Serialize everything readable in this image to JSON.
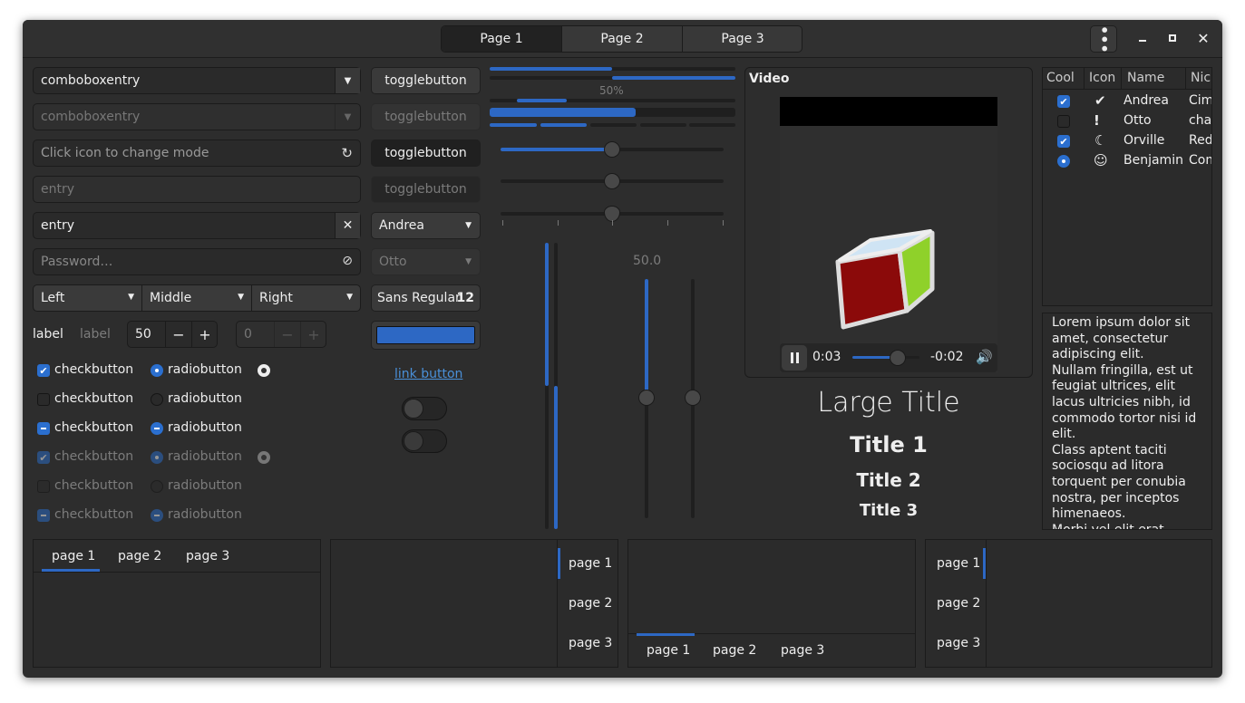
{
  "header": {
    "tabs": [
      "Page 1",
      "Page 2",
      "Page 3"
    ],
    "menu_icon": "more-vert-icon",
    "minimize_icon": "minimize-icon",
    "maximize_icon": "maximize-icon",
    "close_icon": "close-icon"
  },
  "col1": {
    "combo1": "comboboxentry",
    "combo2": "comboboxentry",
    "mode_ph": "Click icon to change mode",
    "entry_ph": "entry",
    "entry_val": "entry",
    "pass_ph": "Password…",
    "left": "Left",
    "middle": "Middle",
    "right": "Right",
    "label1": "label",
    "label2": "label",
    "spin1": "50",
    "spin2": "0",
    "checks": [
      "checkbutton",
      "checkbutton",
      "checkbutton",
      "checkbutton",
      "checkbutton",
      "checkbutton"
    ],
    "radios": [
      "radiobutton",
      "radiobutton",
      "radiobutton",
      "radiobutton",
      "radiobutton",
      "radiobutton"
    ]
  },
  "col2": {
    "toggles": [
      "togglebutton",
      "togglebutton",
      "togglebutton",
      "togglebutton"
    ],
    "combo_andrea": "Andrea",
    "combo_otto": "Otto",
    "font_name": "Sans Regular",
    "font_size": "12",
    "color_value": "#2d68c4",
    "link": "link button"
  },
  "col3": {
    "progress_label": "50%",
    "scale_label": "50.0",
    "progress_value": 0.5
  },
  "video": {
    "title": "Video",
    "time": "0:03",
    "remaining": "-0:02"
  },
  "titles": {
    "large": "Large Title",
    "t1": "Title 1",
    "t2": "Title 2",
    "t3": "Title 3"
  },
  "tree": {
    "headers": [
      "Cool",
      "Icon",
      "Name",
      "Nic"
    ],
    "rows": [
      {
        "name": "Andrea",
        "nick": "Cim",
        "icon": "check-circle-icon"
      },
      {
        "name": "Otto",
        "nick": "chac",
        "icon": "alert-circle-icon"
      },
      {
        "name": "Orville",
        "nick": "Red",
        "icon": "moon-icon"
      },
      {
        "name": "Benjamin",
        "nick": "Com",
        "icon": "face-icon"
      }
    ]
  },
  "textview": "Lorem ipsum dolor sit amet, consectetur adipiscing elit.\nNullam fringilla, est ut feugiat ultrices, elit lacus ultricies nibh, id commodo tortor nisi id elit.\nClass aptent taciti sociosqu ad litora torquent per conubia nostra, per inceptos himenaeos.\nMorbi vel elit erat",
  "notebooks": {
    "tabs": [
      "page 1",
      "page 2",
      "page 3"
    ]
  }
}
